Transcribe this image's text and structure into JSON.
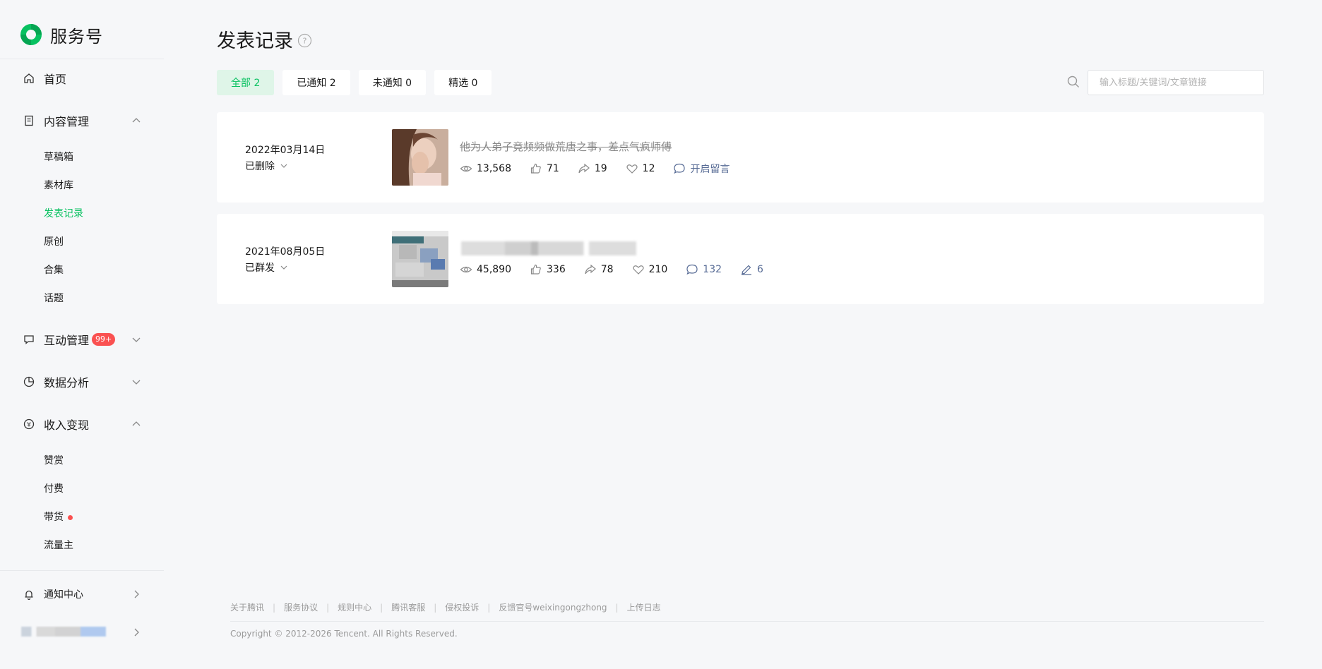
{
  "brand": {
    "name": "服务号"
  },
  "sidebar": {
    "home": "首页",
    "content_mgmt": "内容管理",
    "content_items": [
      "草稿箱",
      "素材库",
      "发表记录",
      "原创",
      "合集",
      "话题"
    ],
    "interaction": "互动管理",
    "interaction_badge": "99+",
    "data_analysis": "数据分析",
    "monetization": "收入变现",
    "monetization_items": [
      "赞赏",
      "付费",
      "带货",
      "流量主"
    ],
    "notifications": "通知中心"
  },
  "page": {
    "title": "发表记录",
    "tabs": [
      "全部 2",
      "已通知 2",
      "未通知 0",
      "精选 0"
    ],
    "search_placeholder": "输入标题/关键词/文章链接"
  },
  "articles": [
    {
      "date": "2022年03月14日",
      "status": "已删除",
      "title": "他为人弟子竟频频做荒唐之事，差点气疯师傅",
      "reads": "13,568",
      "likes": "71",
      "shares": "19",
      "wows": "12",
      "comments": "开启留言"
    },
    {
      "date": "2021年08月05日",
      "status": "已群发",
      "reads": "45,890",
      "likes": "336",
      "shares": "78",
      "wows": "210",
      "comments": "132",
      "edits": "6"
    }
  ],
  "footer": {
    "links": [
      "关于腾讯",
      "服务协议",
      "规则中心",
      "腾讯客服",
      "侵权投诉",
      "反馈官号weixingongzhong",
      "上传日志"
    ],
    "copyright": "Copyright © 2012-2026 Tencent. All Rights Reserved."
  },
  "colors": {
    "accent": "#07c160",
    "link": "#576b95",
    "badge": "#fa5151"
  }
}
